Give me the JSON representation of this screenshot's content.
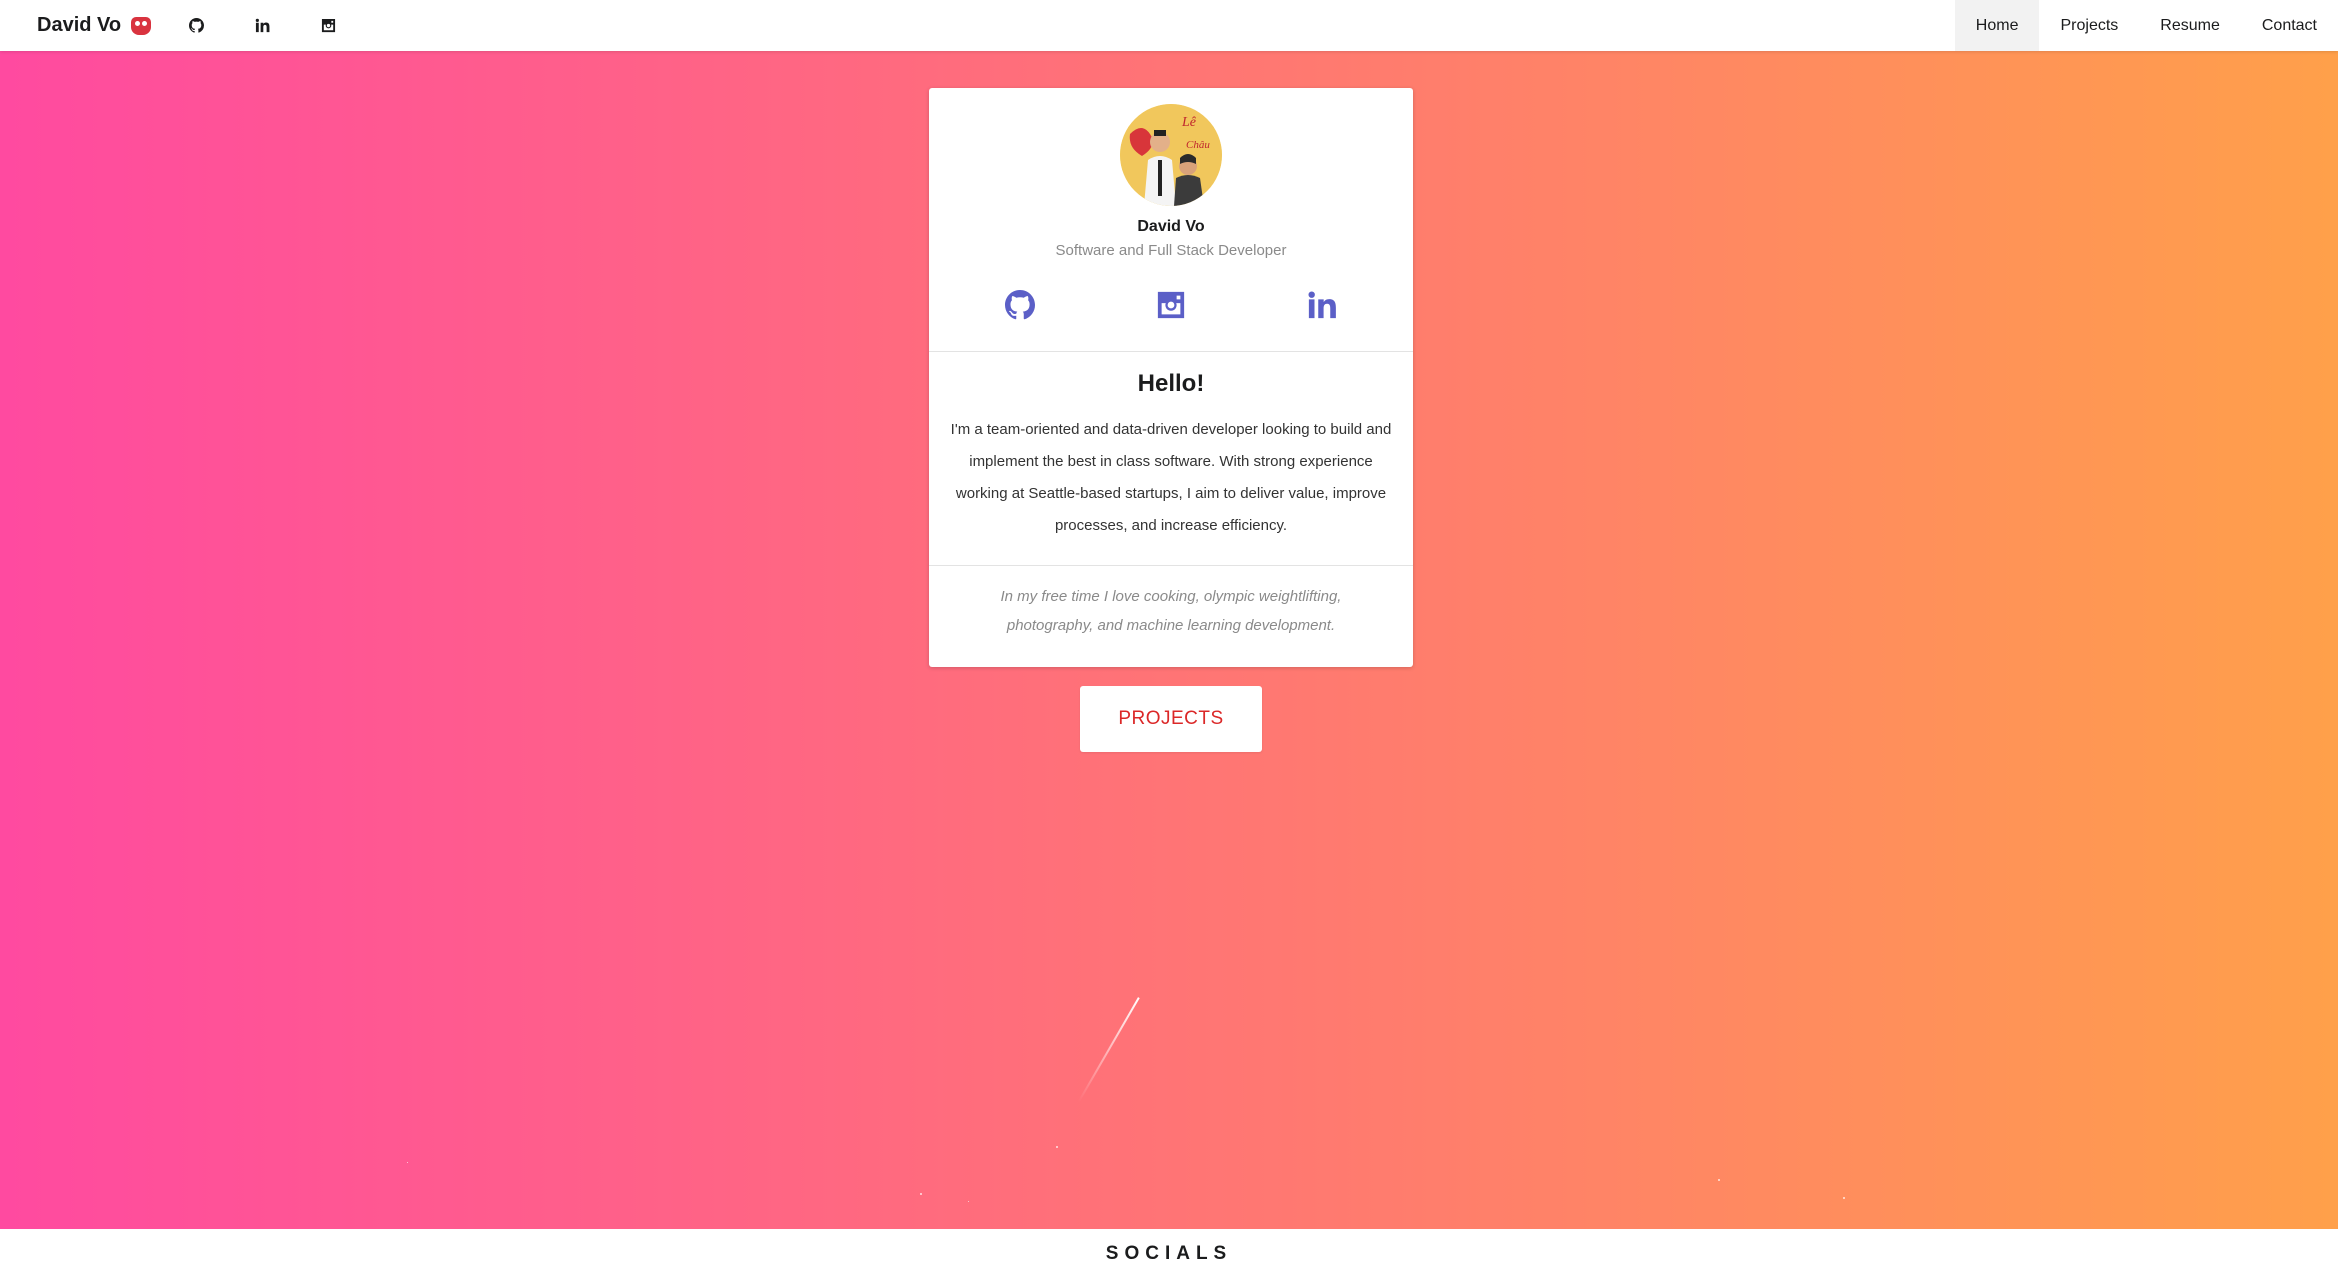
{
  "nav": {
    "brand": "David Vo",
    "brand_icon": "owl-emoji-icon",
    "icons": [
      "github-icon",
      "linkedin-icon",
      "instagram-icon"
    ],
    "links": [
      {
        "label": "Home",
        "active": true
      },
      {
        "label": "Projects",
        "active": false
      },
      {
        "label": "Resume",
        "active": false
      },
      {
        "label": "Contact",
        "active": false
      }
    ]
  },
  "card": {
    "name": "David Vo",
    "role": "Software and Full Stack Developer",
    "social_icons": [
      "github-icon",
      "instagram-icon",
      "linkedin-icon"
    ],
    "hello": "Hello!",
    "bio": "I'm a team-oriented and data-driven developer looking to build and implement the best in class software. With strong experience working at Seattle-based startups, I aim to deliver value, improve processes, and increase efficiency.",
    "hobbies": "In my free time I love cooking, olympic weightlifting, photography, and machine learning development."
  },
  "cta": {
    "label": "PROJECTS"
  },
  "socials": {
    "title": "SOCIALS"
  },
  "colors": {
    "gradient_start": "#ff4aa0",
    "gradient_end": "#ffa04a",
    "icon_accent": "#5b5fc7",
    "cta_text": "#db2828"
  }
}
